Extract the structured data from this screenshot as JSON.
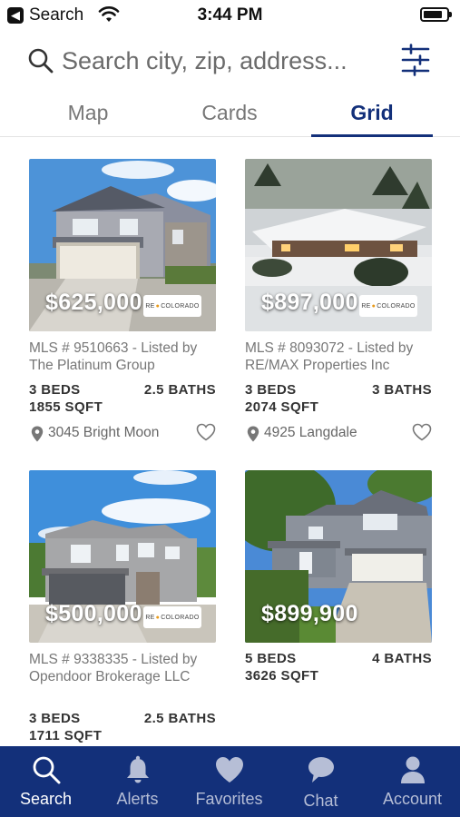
{
  "status_bar": {
    "back_label": "Search",
    "time": "3:44 PM",
    "battery_level": 0.85
  },
  "search": {
    "placeholder": "Search city, zip, address..."
  },
  "tabs": [
    {
      "label": "Map",
      "active": false
    },
    {
      "label": "Cards",
      "active": false
    },
    {
      "label": "Grid",
      "active": true
    }
  ],
  "listings": [
    {
      "price": "$625,000",
      "mls": "MLS # 9510663 - Listed by The Platinum Group",
      "beds": "3 BEDS",
      "baths": "2.5 BATHS",
      "sqft": "1855 SQFT",
      "address": "3045 Bright Moon",
      "brand": "RE COLORADO"
    },
    {
      "price": "$897,000",
      "mls": "MLS # 8093072 - Listed by RE/MAX Properties Inc",
      "beds": "3 BEDS",
      "baths": "3 BATHS",
      "sqft": "2074 SQFT",
      "address": "4925 Langdale",
      "brand": "RE COLORADO"
    },
    {
      "price": "$500,000",
      "mls": "MLS # 9338335 - Listed by Opendoor Brokerage LLC",
      "beds": "3 BEDS",
      "baths": "2.5 BATHS",
      "sqft": "1711 SQFT",
      "brand": "RE COLORADO"
    },
    {
      "price": "$899,900",
      "beds": "5 BEDS",
      "baths": "4 BATHS",
      "sqft": "3626 SQFT"
    }
  ],
  "bottom_nav": [
    {
      "label": "Search",
      "icon": "search-icon",
      "active": true
    },
    {
      "label": "Alerts",
      "icon": "bell-icon",
      "active": false
    },
    {
      "label": "Favorites",
      "icon": "heart-icon",
      "active": false
    },
    {
      "label": "Chat",
      "icon": "chat-bubble-icon",
      "active": false
    },
    {
      "label": "Account",
      "icon": "person-icon",
      "active": false
    }
  ],
  "colors": {
    "brand_navy": "#13307a",
    "inactive_nav": "#b6bed6",
    "tab_inactive": "#777777"
  }
}
